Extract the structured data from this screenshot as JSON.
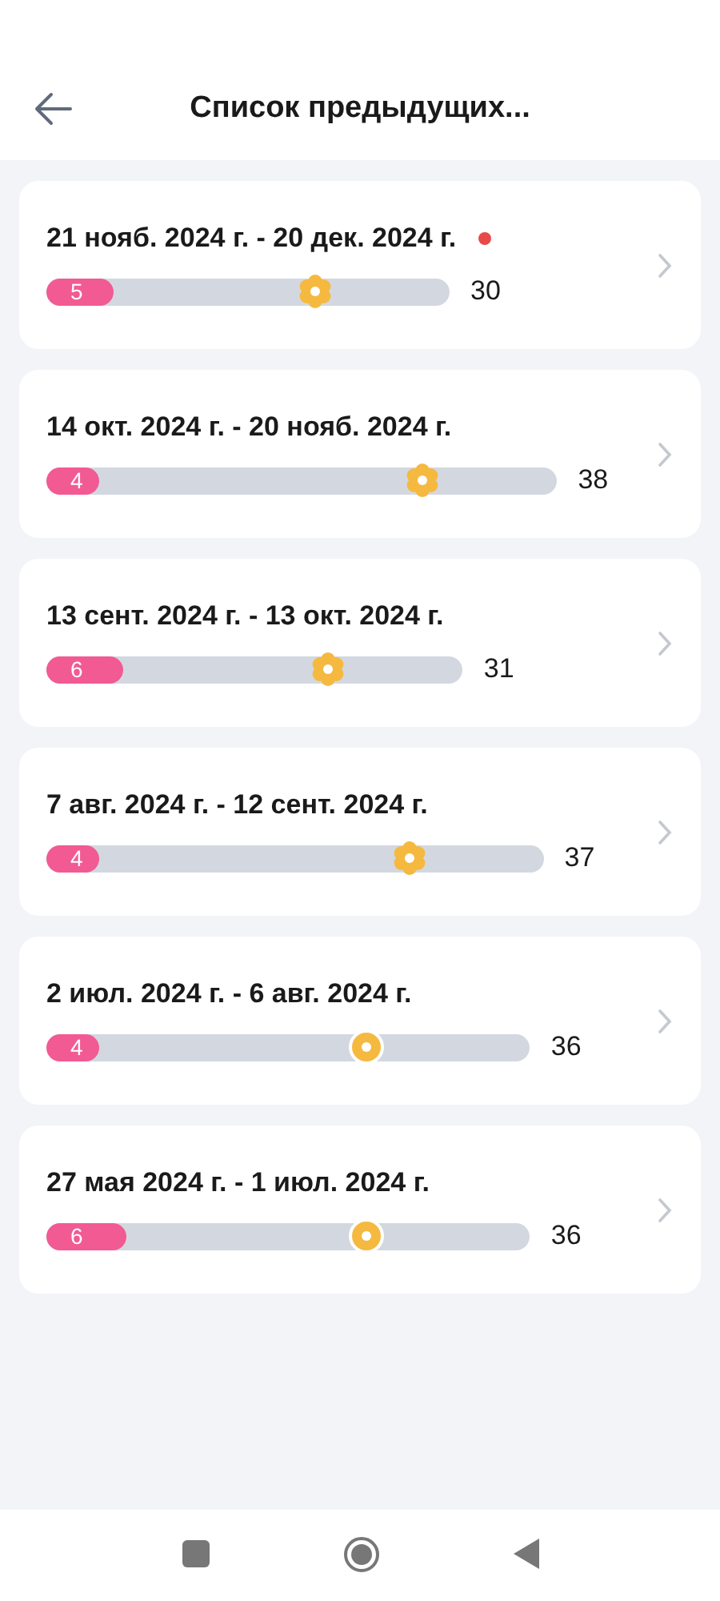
{
  "header": {
    "title": "Список предыдущих..."
  },
  "cycles": [
    {
      "range": "21 нояб. 2024 г. - 20 дек. 2024 г.",
      "current": true,
      "length": "30",
      "period": {
        "days": "5",
        "level": 0.165
      },
      "ovulation": {
        "kind": "flower"
      }
    },
    {
      "range": "14 окт. 2024 г. - 20 нояб. 2024 г.",
      "current": false,
      "length": "38",
      "period": {
        "days": "4",
        "level": 0.104
      },
      "ovulation": {
        "kind": "flower"
      }
    },
    {
      "range": "13 сент. 2024 г. - 13 окт. 2024 г.",
      "current": false,
      "length": "31",
      "period": {
        "days": "6",
        "level": 0.185
      },
      "ovulation": {
        "kind": "flower"
      }
    },
    {
      "range": "7 авг. 2024 г. - 12 сент. 2024 г.",
      "current": false,
      "length": "37",
      "period": {
        "days": "4",
        "level": 0.107
      },
      "ovulation": {
        "kind": "flower"
      }
    },
    {
      "range": "2 июл. 2024 г. - 6 авг. 2024 г.",
      "current": false,
      "length": "36",
      "period": {
        "days": "4",
        "level": 0.11
      },
      "ovulation": {
        "kind": "dot",
        "level": 0.66
      }
    },
    {
      "range": "27 мая 2024 г. - 1 июл. 2024 г.",
      "current": false,
      "length": "36",
      "period": {
        "days": "6",
        "level": 0.166
      },
      "ovulation": {
        "kind": "dot",
        "level": 0.66
      }
    }
  ]
}
